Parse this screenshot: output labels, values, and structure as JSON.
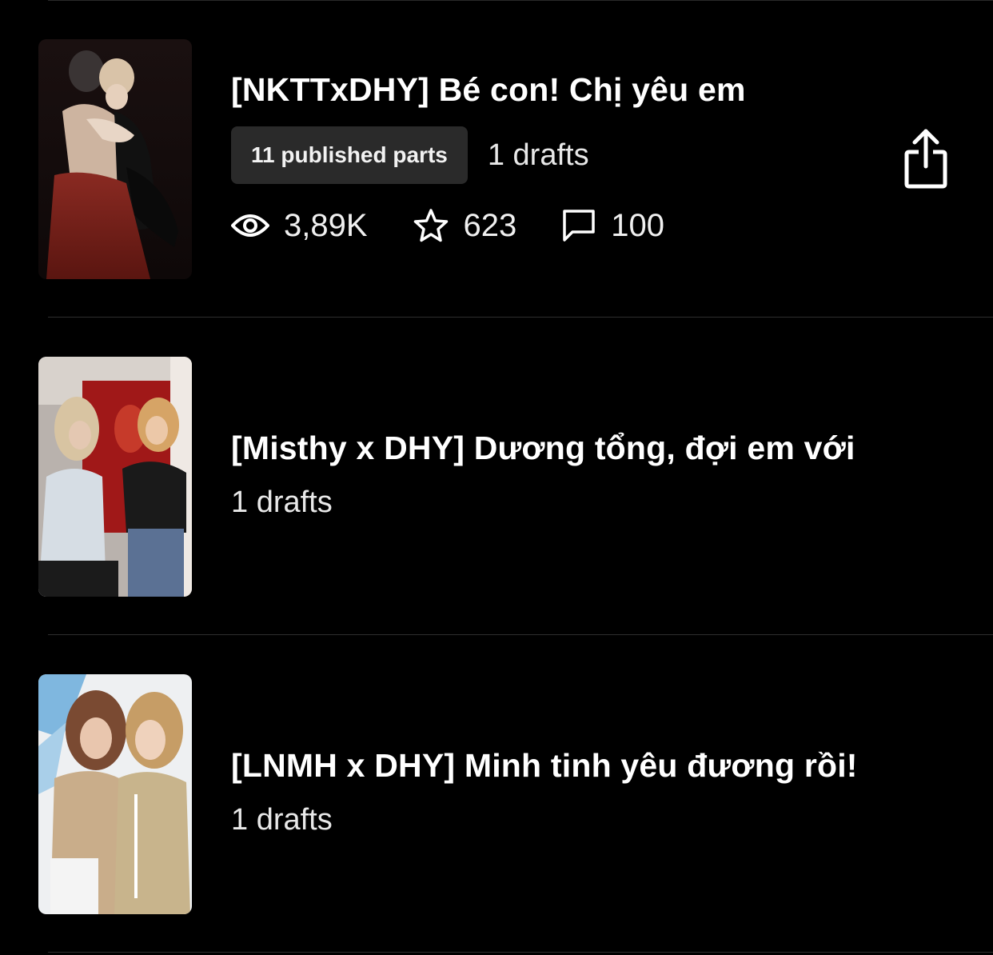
{
  "stories": [
    {
      "title": "[NKTTxDHY] Bé con! Chị yêu em",
      "published_label": "11 published parts",
      "drafts_label": "1 drafts",
      "stats": {
        "views": "3,89K",
        "votes": "623",
        "comments": "100"
      },
      "cover_icon": "illustrated-couple-cover"
    },
    {
      "title": "[Misthy x DHY] Dương tổng, đợi em với",
      "drafts_label": "1 drafts",
      "cover_icon": "photo-cover"
    },
    {
      "title": "[LNMH x DHY] Minh tinh yêu đương rồi!",
      "drafts_label": "1 drafts",
      "cover_icon": "photo-cover"
    }
  ],
  "icons": {
    "views": "eye-icon",
    "votes": "star-icon",
    "comments": "comment-icon",
    "share": "share-icon"
  },
  "colors": {
    "background": "#000000",
    "badge_background": "#2a2a2a",
    "divider": "#2e2e2e",
    "text": "#ffffff"
  }
}
